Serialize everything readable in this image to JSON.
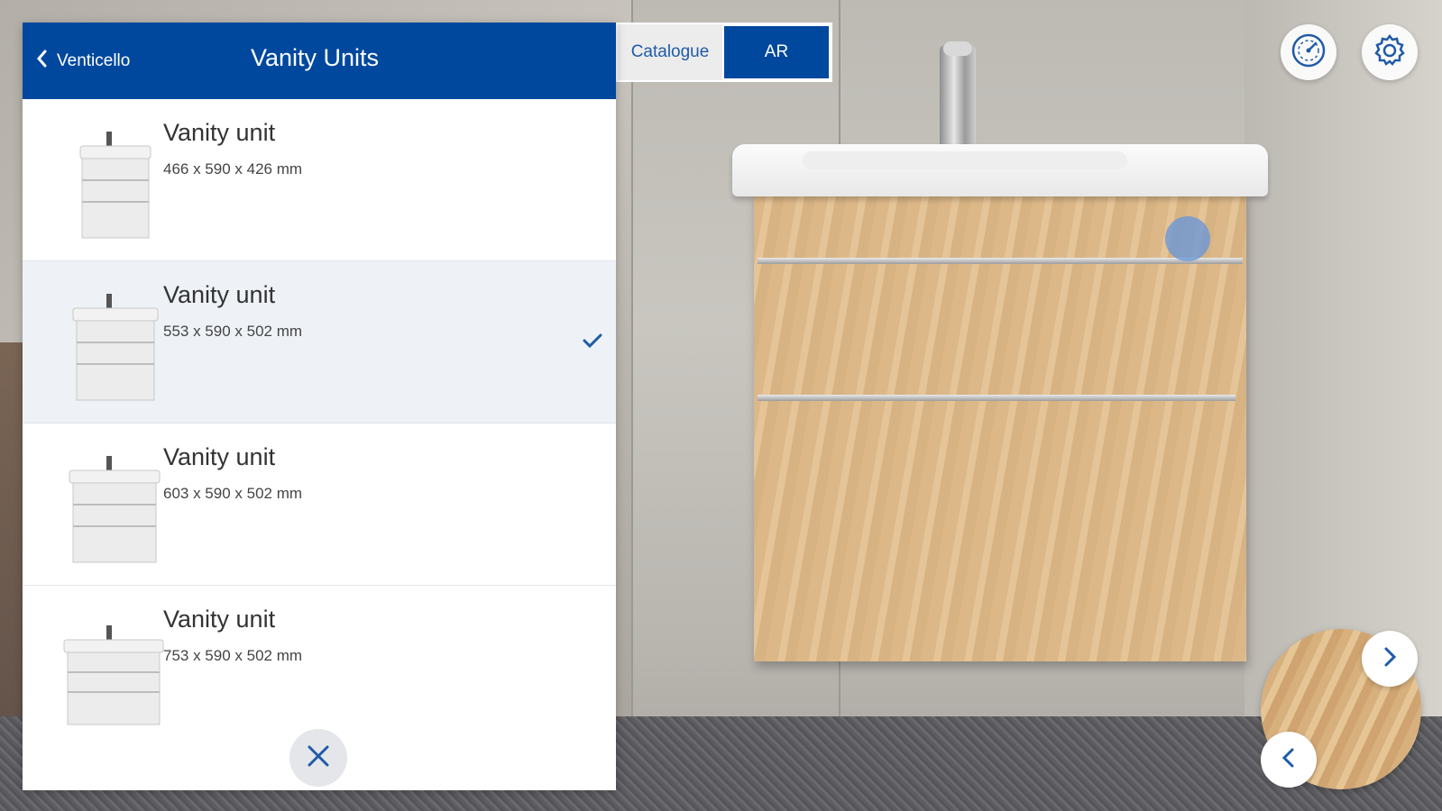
{
  "panel": {
    "back_label": "Venticello",
    "title": "Vanity Units",
    "close_icon": "close-icon"
  },
  "view_toggle": {
    "catalogue_label": "Catalogue",
    "ar_label": "AR",
    "active": "AR"
  },
  "products": [
    {
      "name": "Vanity unit",
      "dimensions": "466 x 590 x 426 mm",
      "selected": false
    },
    {
      "name": "Vanity unit",
      "dimensions": "553 x 590 x 502 mm",
      "selected": true
    },
    {
      "name": "Vanity unit",
      "dimensions": "603 x 590 x 502 mm",
      "selected": false
    },
    {
      "name": "Vanity unit",
      "dimensions": "753 x 590 x 502 mm",
      "selected": false
    }
  ],
  "toolbar": {
    "performance_icon": "speedometer-icon",
    "settings_icon": "gear-icon"
  },
  "material_picker": {
    "prev_icon": "chevron-left-icon",
    "next_icon": "chevron-right-icon"
  },
  "colors": {
    "brand_blue": "#00489d",
    "selected_row": "#eef2f7",
    "wood": "#dcb888"
  }
}
